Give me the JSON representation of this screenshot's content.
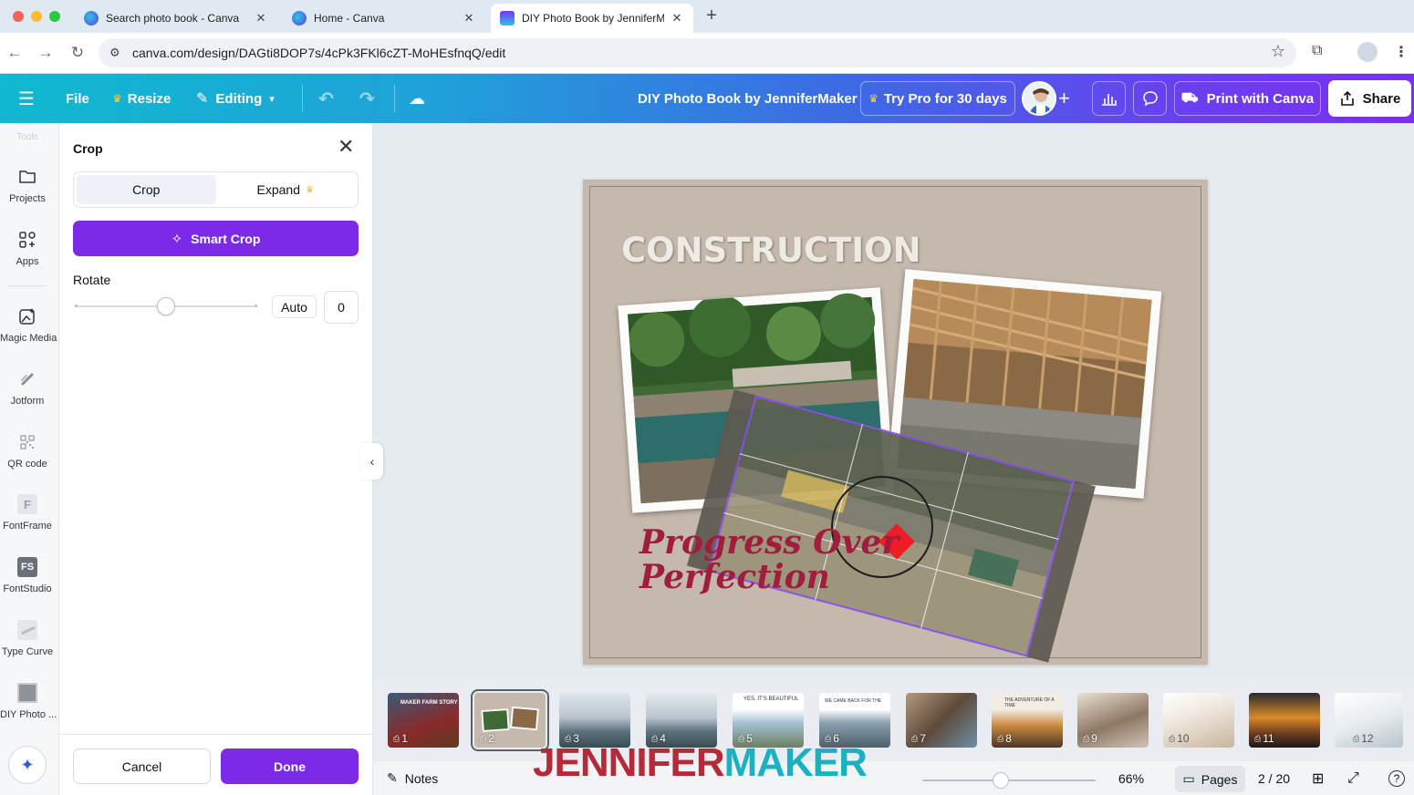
{
  "browser": {
    "tabs": [
      {
        "title": "Search photo book - Canva",
        "active": false
      },
      {
        "title": "Home - Canva",
        "active": false
      },
      {
        "title": "DIY Photo Book by JenniferM",
        "active": true
      }
    ],
    "url": "canva.com/design/DAGti8DOP7s/4cPk3FKl6cZT-MoHEsfnqQ/edit"
  },
  "header": {
    "file": "File",
    "resize": "Resize",
    "editing": "Editing",
    "doc_title": "DIY Photo Book by JenniferMaker",
    "try_pro": "Try Pro for 30 days",
    "print": "Print with Canva",
    "share": "Share"
  },
  "rail": {
    "faded_label": "Tools",
    "items": [
      {
        "label": "Projects",
        "icon": "folder-icon"
      },
      {
        "label": "Apps",
        "icon": "apps-grid-icon"
      },
      {
        "label": "Magic Media",
        "icon": "magic-media-icon"
      },
      {
        "label": "Jotform",
        "icon": "jotform-icon"
      },
      {
        "label": "QR code",
        "icon": "qr-code-icon"
      },
      {
        "label": "FontFrame",
        "icon": "fontframe-icon"
      },
      {
        "label": "FontStudio",
        "icon": "fontstudio-icon"
      },
      {
        "label": "Type Curve",
        "icon": "type-curve-icon"
      },
      {
        "label": "DIY Photo ...",
        "icon": "diy-photo-icon"
      }
    ]
  },
  "crop_panel": {
    "title": "Crop",
    "tab_crop": "Crop",
    "tab_expand": "Expand",
    "smart_crop": "Smart Crop",
    "rotate_label": "Rotate",
    "rotate_slider_fraction": 0.5,
    "auto_label": "Auto",
    "rotate_value": "0",
    "cancel": "Cancel",
    "done": "Done"
  },
  "canvas": {
    "title": "CONSTRUCTION",
    "script_line1": "Progress Over",
    "script_line2": "Perfection"
  },
  "filmstrip": {
    "pages": [
      "1",
      "2",
      "3",
      "4",
      "5",
      "6",
      "7",
      "8",
      "9",
      "10",
      "11",
      "12"
    ],
    "selected": "2",
    "thumb_texts": {
      "t1": "MAKER FARM STORY",
      "t5": "YES, IT'S BEAUTIFUL",
      "t6": "WE CAME BACK FOR THE",
      "t8": "THE ADVENTURE OF A TIME"
    }
  },
  "footer": {
    "notes": "Notes",
    "zoom": "66%",
    "zoom_slider_fraction": 0.45,
    "pages": "Pages",
    "page_count": "2 / 20"
  },
  "watermark": {
    "part1": "JENNIFER",
    "part2": "MAKER"
  },
  "colors": {
    "accent_purple": "#7d2ae8",
    "header_start": "#10b9cf",
    "header_end": "#7b2ff2",
    "script_red": "#a11d3d"
  }
}
